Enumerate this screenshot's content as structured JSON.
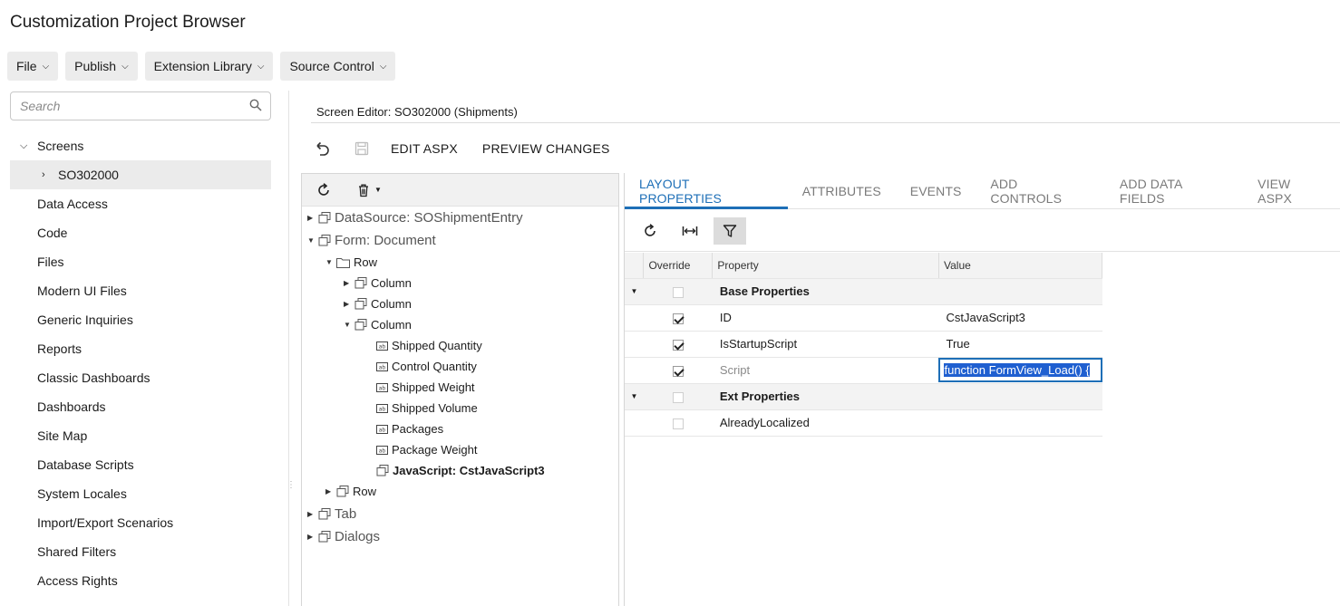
{
  "app": {
    "title": "Customization Project Browser"
  },
  "menubar": [
    {
      "label": "File"
    },
    {
      "label": "Publish"
    },
    {
      "label": "Extension Library"
    },
    {
      "label": "Source Control"
    }
  ],
  "search": {
    "placeholder": "Search",
    "value": ""
  },
  "nav": {
    "screens_label": "Screens",
    "screen_item": "SO302000",
    "items": [
      "Data Access",
      "Code",
      "Files",
      "Modern UI Files",
      "Generic Inquiries",
      "Reports",
      "Classic Dashboards",
      "Dashboards",
      "Site Map",
      "Database Scripts",
      "System Locales",
      "Import/Export Scenarios",
      "Shared Filters",
      "Access Rights"
    ]
  },
  "editor": {
    "title": "Screen Editor: SO302000 (Shipments)",
    "edit_aspx": "EDIT ASPX",
    "preview_changes": "PREVIEW CHANGES"
  },
  "tree": {
    "datasource": "DataSource: SOShipmentEntry",
    "form": "Form: Document",
    "row": "Row",
    "column1": "Column",
    "column2": "Column",
    "column3": "Column",
    "fields": [
      "Shipped Quantity",
      "Control Quantity",
      "Shipped Weight",
      "Shipped Volume",
      "Packages",
      "Package Weight"
    ],
    "javascript": "JavaScript: CstJavaScript3",
    "row2": "Row",
    "tab": "Tab",
    "dialogs": "Dialogs"
  },
  "tabs": [
    "LAYOUT PROPERTIES",
    "ATTRIBUTES",
    "EVENTS",
    "ADD CONTROLS",
    "ADD DATA FIELDS",
    "VIEW ASPX"
  ],
  "grid": {
    "headers": {
      "override": "Override",
      "property": "Property",
      "value": "Value"
    },
    "base_group": "Base Properties",
    "id_prop": "ID",
    "id_value": "CstJavaScript3",
    "startup_prop": "IsStartupScript",
    "startup_value": "True",
    "script_prop": "Script",
    "script_value": "function FormView_Load() {",
    "ext_group": "Ext Properties",
    "localized_prop": "AlreadyLocalized",
    "localized_value": ""
  },
  "colors": {
    "accent": "#1e6fb7",
    "selection": "#1f5fd0"
  }
}
